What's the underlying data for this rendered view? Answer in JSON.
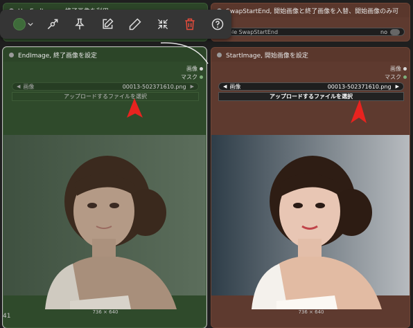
{
  "nodes": {
    "use_end_image": {
      "title": "UseEndImage, 終了画像を利用"
    },
    "swap_start_end": {
      "title": "SwapStartEnd, 開始画像と終了画像を入替、開始画像のみ可",
      "toggle_label": "able SwapStartEnd",
      "toggle_value": "no"
    },
    "end_image": {
      "title": "EndImage, 終了画像を設定",
      "output_image": "画像",
      "output_mask": "マスク",
      "combo_label": "画像",
      "combo_value": "00013-502371610.png",
      "upload_label": "アップロードするファイルを選択",
      "image_size": "736 × 640"
    },
    "start_image": {
      "title": "StartImage, 開始画像を設定",
      "output_image": "画像",
      "output_mask": "マスク",
      "combo_label": "画像",
      "combo_value": "00013-502371610.png",
      "upload_label": "アップロードするファイルを選択",
      "image_size": "736 × 640"
    }
  },
  "toolbar": {
    "buttons": [
      "color-picker",
      "bypass-icon",
      "pin-icon",
      "edit-icon",
      "pencil-icon",
      "collapse-icon",
      "delete-icon",
      "help-icon"
    ]
  },
  "edge_label": "41",
  "colors": {
    "green_node": "#2f4a2b",
    "brown_node": "#5e3a2f",
    "delete_red": "#e74c3c",
    "arrow_red": "#e8231f"
  }
}
